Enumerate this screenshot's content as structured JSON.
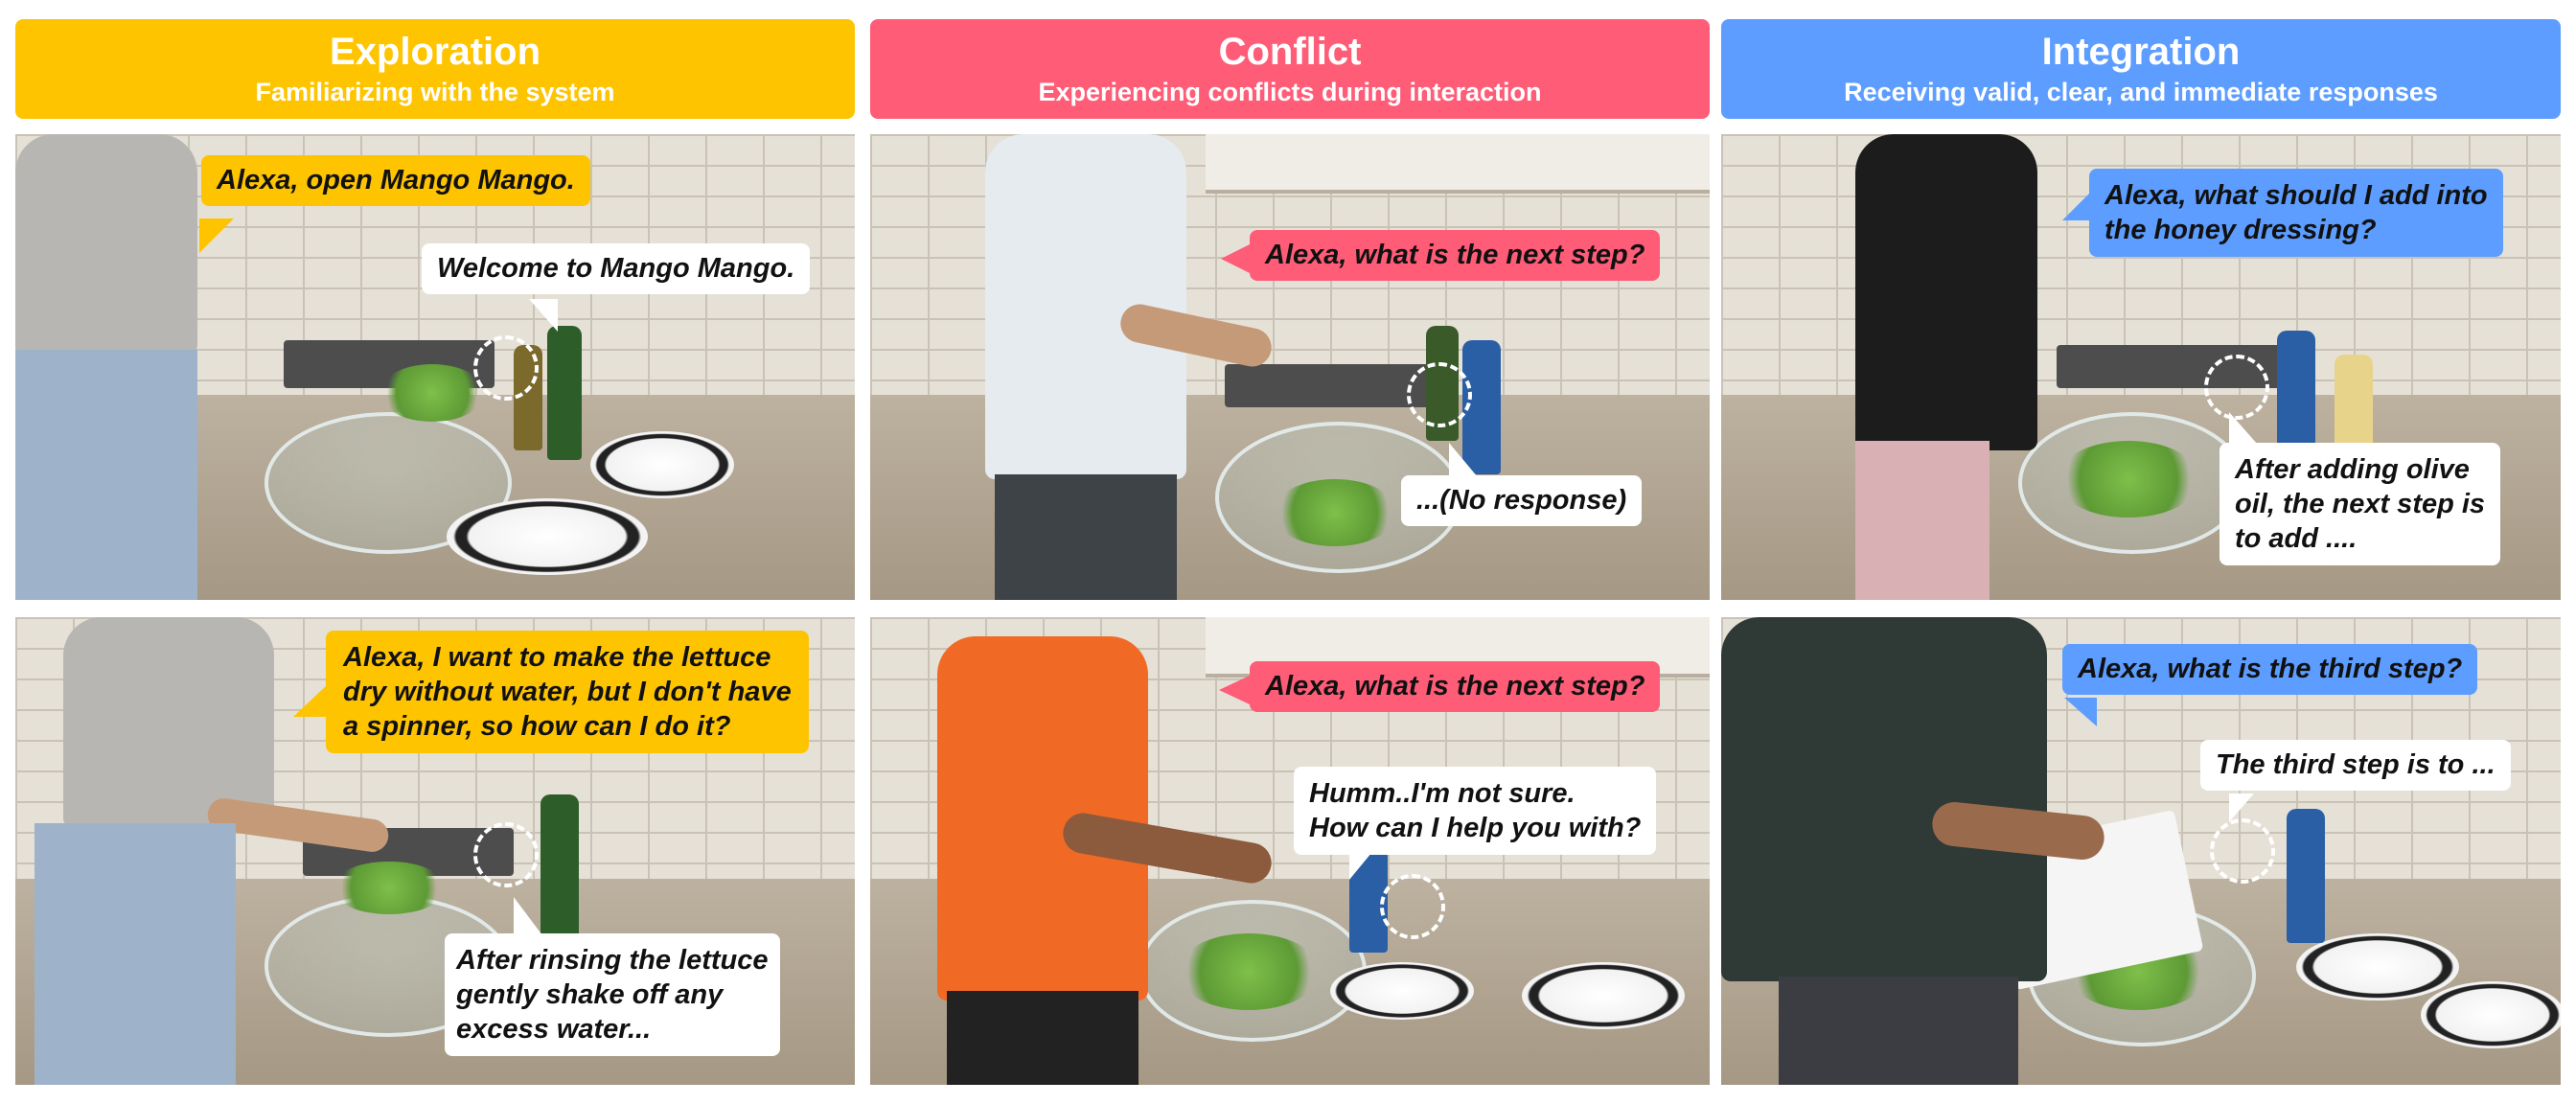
{
  "headers": [
    {
      "title": "Exploration",
      "subtitle": "Familiarizing with the system",
      "color": "#ffc400"
    },
    {
      "title": "Conflict",
      "subtitle": "Experiencing conflicts during interaction",
      "color": "#ff5c77"
    },
    {
      "title": "Integration",
      "subtitle": "Receiving valid, clear, and immediate responses",
      "color": "#5c9dff"
    }
  ],
  "panels": {
    "explore_top": {
      "user": [
        "Alexa, open Mango Mango."
      ],
      "system": [
        "Welcome to Mango Mango."
      ]
    },
    "explore_bottom": {
      "user": [
        "Alexa, I want to make the lettuce",
        "dry without water, but I don't have",
        "a spinner, so how can I do it?"
      ],
      "system": [
        "After rinsing the lettuce",
        "gently shake off any",
        "excess water..."
      ]
    },
    "conflict_top": {
      "user": [
        "Alexa, what is the next step?"
      ],
      "system": [
        "...(No response)"
      ]
    },
    "conflict_bottom": {
      "user": [
        "Alexa, what is the next step?"
      ],
      "system": [
        "Humm..I'm not sure.",
        "How can I help you with?"
      ]
    },
    "integrate_top": {
      "user": [
        "Alexa, what should I add into",
        "the honey dressing?"
      ],
      "system": [
        "After adding olive",
        "oil, the next step is",
        "to add ...."
      ]
    },
    "integrate_bottom": {
      "user": [
        "Alexa, what is the third step?"
      ],
      "system": [
        "The third step is to ..."
      ]
    }
  }
}
